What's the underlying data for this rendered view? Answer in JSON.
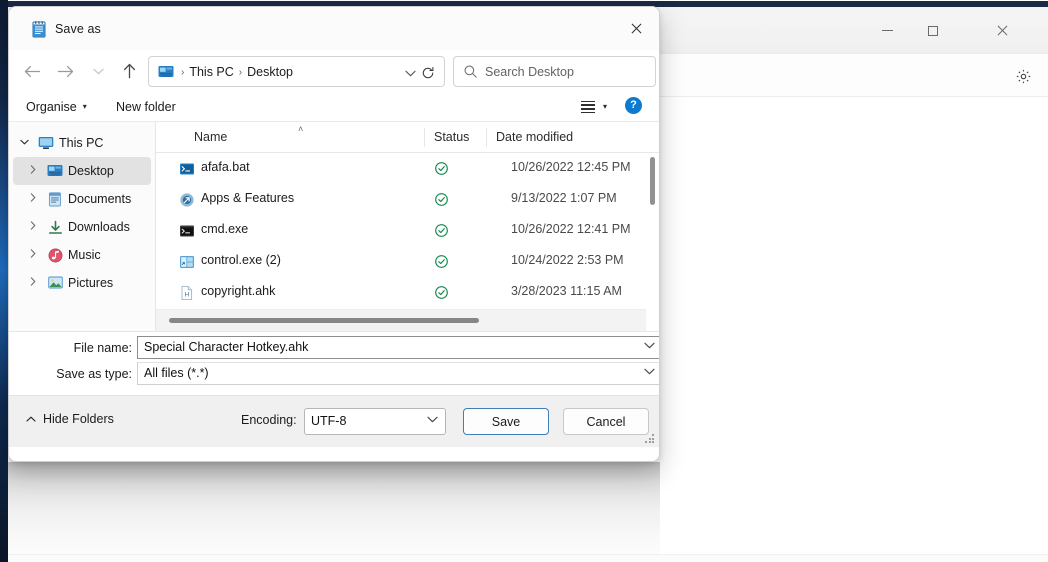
{
  "background_window": {
    "name": "background-app-window",
    "controls": {
      "minimize_label": "Minimize",
      "maximize_label": "Maximize",
      "close_label": "Close"
    },
    "settings_label": "Settings"
  },
  "dialog": {
    "title": "Save as",
    "app_icon": "notepad-icon",
    "close_label": "Close",
    "nav": {
      "back_label": "Back",
      "forward_label": "Forward",
      "recent_label": "Recent locations",
      "up_label": "Up to This PC"
    },
    "address": {
      "folder_icon": "desktop-folder-icon",
      "crumbs": [
        "This PC",
        "Desktop"
      ],
      "separator": "›",
      "chevron": "⌄",
      "refresh_label": "Refresh"
    },
    "search": {
      "placeholder": "Search Desktop",
      "value": "",
      "icon": "search-icon"
    },
    "commandbar": {
      "organise_label": "Organise",
      "organise_caret": "▾",
      "new_folder_label": "New folder",
      "view_label": "View",
      "view_caret": "▾",
      "help_label": "?"
    },
    "sidebar": {
      "items": [
        {
          "label": "This PC",
          "icon": "monitor-icon",
          "twisty": "⌄",
          "expanded": true,
          "selected": false,
          "indent": false
        },
        {
          "label": "Desktop",
          "icon": "desktop-icon",
          "twisty": "›",
          "expanded": false,
          "selected": true,
          "indent": true
        },
        {
          "label": "Documents",
          "icon": "documents-icon",
          "twisty": "›",
          "expanded": false,
          "selected": false,
          "indent": true
        },
        {
          "label": "Downloads",
          "icon": "downloads-icon",
          "twisty": "›",
          "expanded": false,
          "selected": false,
          "indent": true
        },
        {
          "label": "Music",
          "icon": "music-icon",
          "twisty": "›",
          "expanded": false,
          "selected": false,
          "indent": true
        },
        {
          "label": "Pictures",
          "icon": "pictures-icon",
          "twisty": "›",
          "expanded": false,
          "selected": false,
          "indent": true
        }
      ]
    },
    "filelist": {
      "columns": [
        "Name",
        "Status",
        "Date modified"
      ],
      "sort_indicator": "˄",
      "rows": [
        {
          "name": "afafa.bat",
          "icon": "bat-file-icon",
          "status": "synced",
          "date": "10/26/2022 12:45 PM"
        },
        {
          "name": "Apps & Features",
          "icon": "shortcut-icon",
          "status": "synced",
          "date": "9/13/2022 1:07 PM"
        },
        {
          "name": "cmd.exe",
          "icon": "cmd-icon",
          "status": "synced",
          "date": "10/26/2022 12:41 PM"
        },
        {
          "name": "control.exe (2)",
          "icon": "control-panel-icon",
          "status": "synced",
          "date": "10/24/2022 2:53 PM"
        },
        {
          "name": "copyright.ahk",
          "icon": "ahk-file-icon",
          "status": "synced",
          "date": "3/28/2023 11:15 AM"
        }
      ]
    },
    "form": {
      "filename_label": "File name:",
      "filename_value": "Special Character Hotkey.ahk",
      "savetype_label": "Save as type:",
      "savetype_value": "All files  (*.*)",
      "caret": "⌄"
    },
    "footer": {
      "hide_folders_label": "Hide Folders",
      "hide_folders_caret": "˄",
      "encoding_label": "Encoding:",
      "encoding_value": "UTF-8",
      "save_label": "Save",
      "cancel_label": "Cancel"
    }
  },
  "colors": {
    "accent_blue": "#0b7ad1",
    "focus_border": "#3f7fb5",
    "selection_gray": "#e2e2e2",
    "sync_green": "#12894a",
    "navy_strip": "#14284a"
  }
}
